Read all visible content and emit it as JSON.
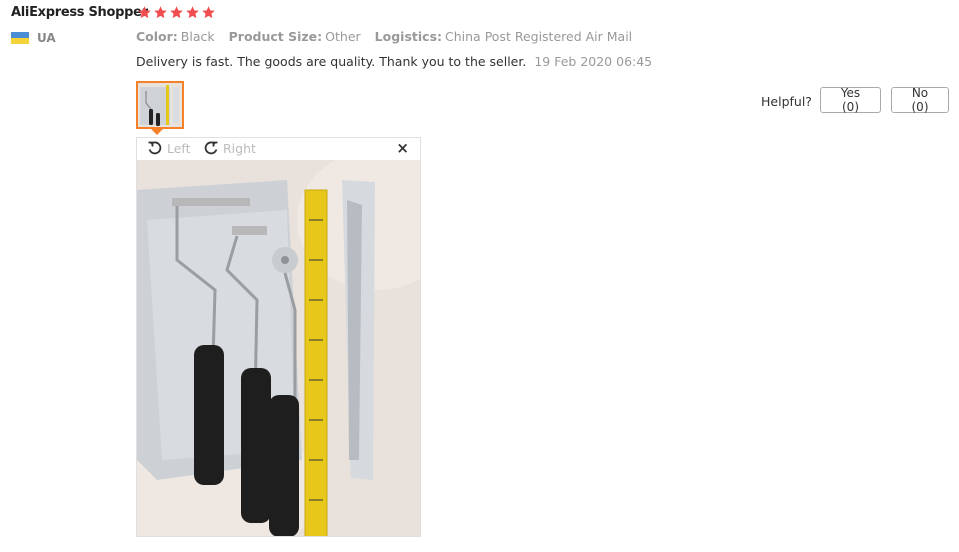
{
  "review": {
    "username": "AliExpress Shopper",
    "rating": 5,
    "country": "UA",
    "specs": [
      {
        "key": "Color:",
        "value": "Black"
      },
      {
        "key": "Product Size:",
        "value": "Other"
      },
      {
        "key": "Logistics:",
        "value": "China Post Registered Air Mail"
      }
    ],
    "text": "Delivery is fast. The goods are quality. Thank you to the seller.",
    "date": "19 Feb 2020 06:45"
  },
  "helpful": {
    "label": "Helpful?",
    "yes": "Yes (0)",
    "no": "No (0)"
  },
  "viewer": {
    "rotate_left": "Left",
    "rotate_right": "Right",
    "close": "×"
  },
  "colors": {
    "star": "#f04e4e",
    "accent": "#f5812a"
  }
}
